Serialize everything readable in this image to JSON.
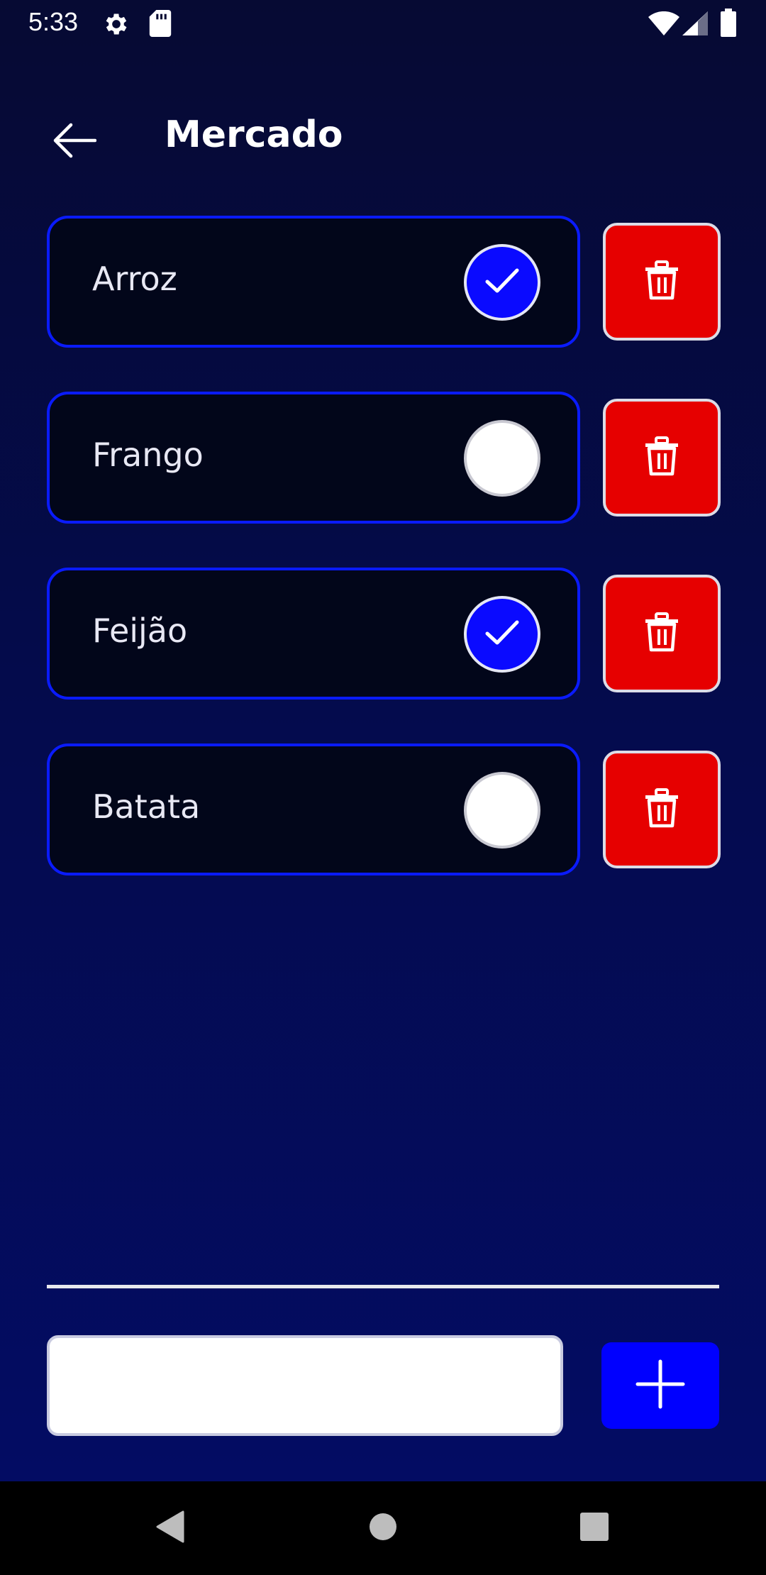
{
  "status_bar": {
    "time": "5:33",
    "icons": [
      "settings-icon",
      "sd-card-icon",
      "wifi-icon",
      "cellular-signal-icon",
      "battery-icon"
    ]
  },
  "header": {
    "title": "Mercado",
    "back_icon": "arrow-left-icon"
  },
  "items": [
    {
      "label": "Arroz",
      "checked": true
    },
    {
      "label": "Frango",
      "checked": false
    },
    {
      "label": "Feijão",
      "checked": true
    },
    {
      "label": "Batata",
      "checked": false
    }
  ],
  "new_item": {
    "value": "",
    "placeholder": "",
    "add_icon": "plus-icon"
  },
  "nav": {
    "icons": [
      "back-triangle-icon",
      "home-circle-icon",
      "recents-square-icon"
    ]
  },
  "colors": {
    "accent": "#0a0aff",
    "delete": "#e60000",
    "card_bg": "#02061a",
    "card_border": "#0a1bff"
  }
}
